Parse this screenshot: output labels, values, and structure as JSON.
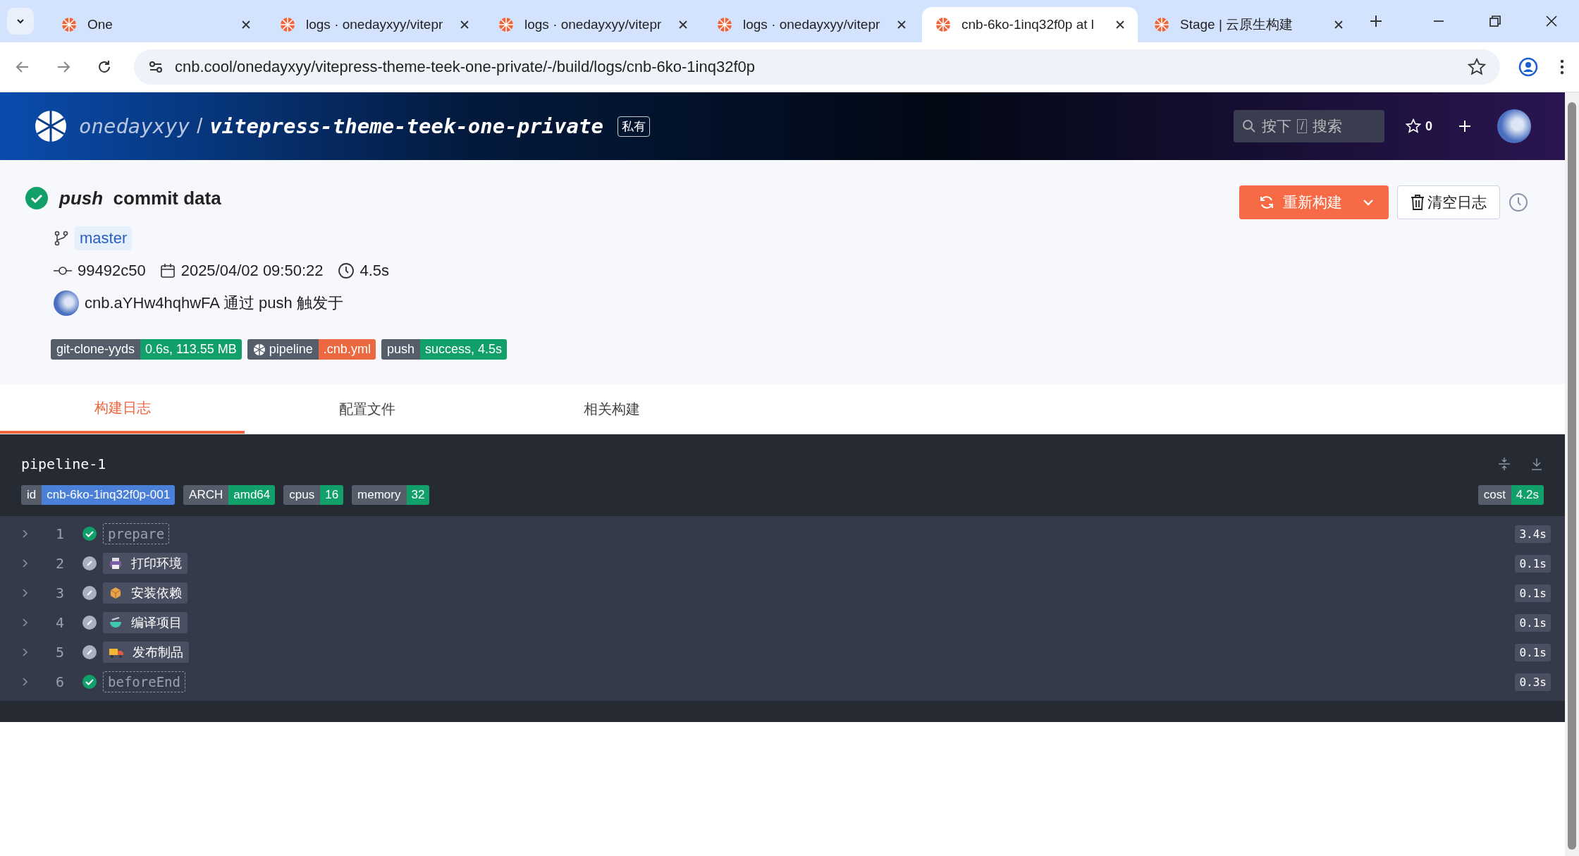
{
  "browser": {
    "tabs": [
      {
        "title": "One",
        "selected": false
      },
      {
        "title": "logs · onedayxyy/vitepr",
        "selected": false
      },
      {
        "title": "logs · onedayxyy/vitepr",
        "selected": false
      },
      {
        "title": "logs · onedayxyy/vitepr",
        "selected": false
      },
      {
        "title": "cnb-6ko-1inq32f0p at l",
        "selected": true
      },
      {
        "title": "Stage | 云原生构建",
        "selected": false
      }
    ],
    "url": "cnb.cool/onedayxyy/vitepress-theme-teek-one-private/-/build/logs/cnb-6ko-1inq32f0p"
  },
  "header": {
    "owner": "onedayxyy",
    "separator": "/",
    "repo": "vitepress-theme-teek-one-private",
    "visibility": "私有",
    "search": {
      "placeholder_prefix": "按下",
      "key": "/",
      "placeholder": "搜索"
    },
    "stars": "0"
  },
  "build": {
    "event": "push",
    "title": "commit data",
    "branch": "master",
    "commit": "99492c50",
    "time": "2025/04/02 09:50:22",
    "duration": "4.5s",
    "trigger": "cnb.aYHw4hqhwFA 通过 push 触发于",
    "badges": [
      {
        "label": "git-clone-yyds",
        "value": "0.6s, 113.55 MB",
        "color": "#12a06a",
        "logo": false
      },
      {
        "label": "pipeline",
        "value": ".cnb.yml",
        "color": "#ec6840",
        "logo": true
      },
      {
        "label": "push",
        "value": "success, 4.5s",
        "color": "#12a06a",
        "logo": false
      }
    ],
    "rebuild_button": "重新构建",
    "clear_button": "清空日志"
  },
  "tabs": [
    {
      "label": "构建日志",
      "selected": true
    },
    {
      "label": "配置文件",
      "selected": false
    },
    {
      "label": "相关构建",
      "selected": false
    }
  ],
  "pipeline": {
    "name": "pipeline-1",
    "tags": [
      {
        "label": "id",
        "value": "cnb-6ko-1inq32f0p-001",
        "color": "#4a80d8"
      },
      {
        "label": "ARCH",
        "value": "amd64",
        "color": "#12a06a"
      },
      {
        "label": "cpus",
        "value": "16",
        "color": "#12a06a"
      },
      {
        "label": "memory",
        "value": "32",
        "color": "#12a06a"
      }
    ],
    "cost": {
      "label": "cost",
      "value": "4.2s",
      "color": "#12a06a"
    },
    "steps": [
      {
        "number": "1",
        "name": "prepare",
        "kind": "plain",
        "success": true,
        "duration": "3.4s"
      },
      {
        "number": "2",
        "name": "打印环境",
        "kind": "icon",
        "success": false,
        "duration": "0.1s"
      },
      {
        "number": "3",
        "name": "安装依赖",
        "kind": "icon",
        "success": false,
        "duration": "0.1s"
      },
      {
        "number": "4",
        "name": "编译项目",
        "kind": "icon",
        "success": false,
        "duration": "0.1s"
      },
      {
        "number": "5",
        "name": "发布制品",
        "kind": "icon",
        "success": false,
        "duration": "0.1s"
      },
      {
        "number": "6",
        "name": "beforeEnd",
        "kind": "plain",
        "success": true,
        "duration": "0.3s"
      }
    ]
  }
}
